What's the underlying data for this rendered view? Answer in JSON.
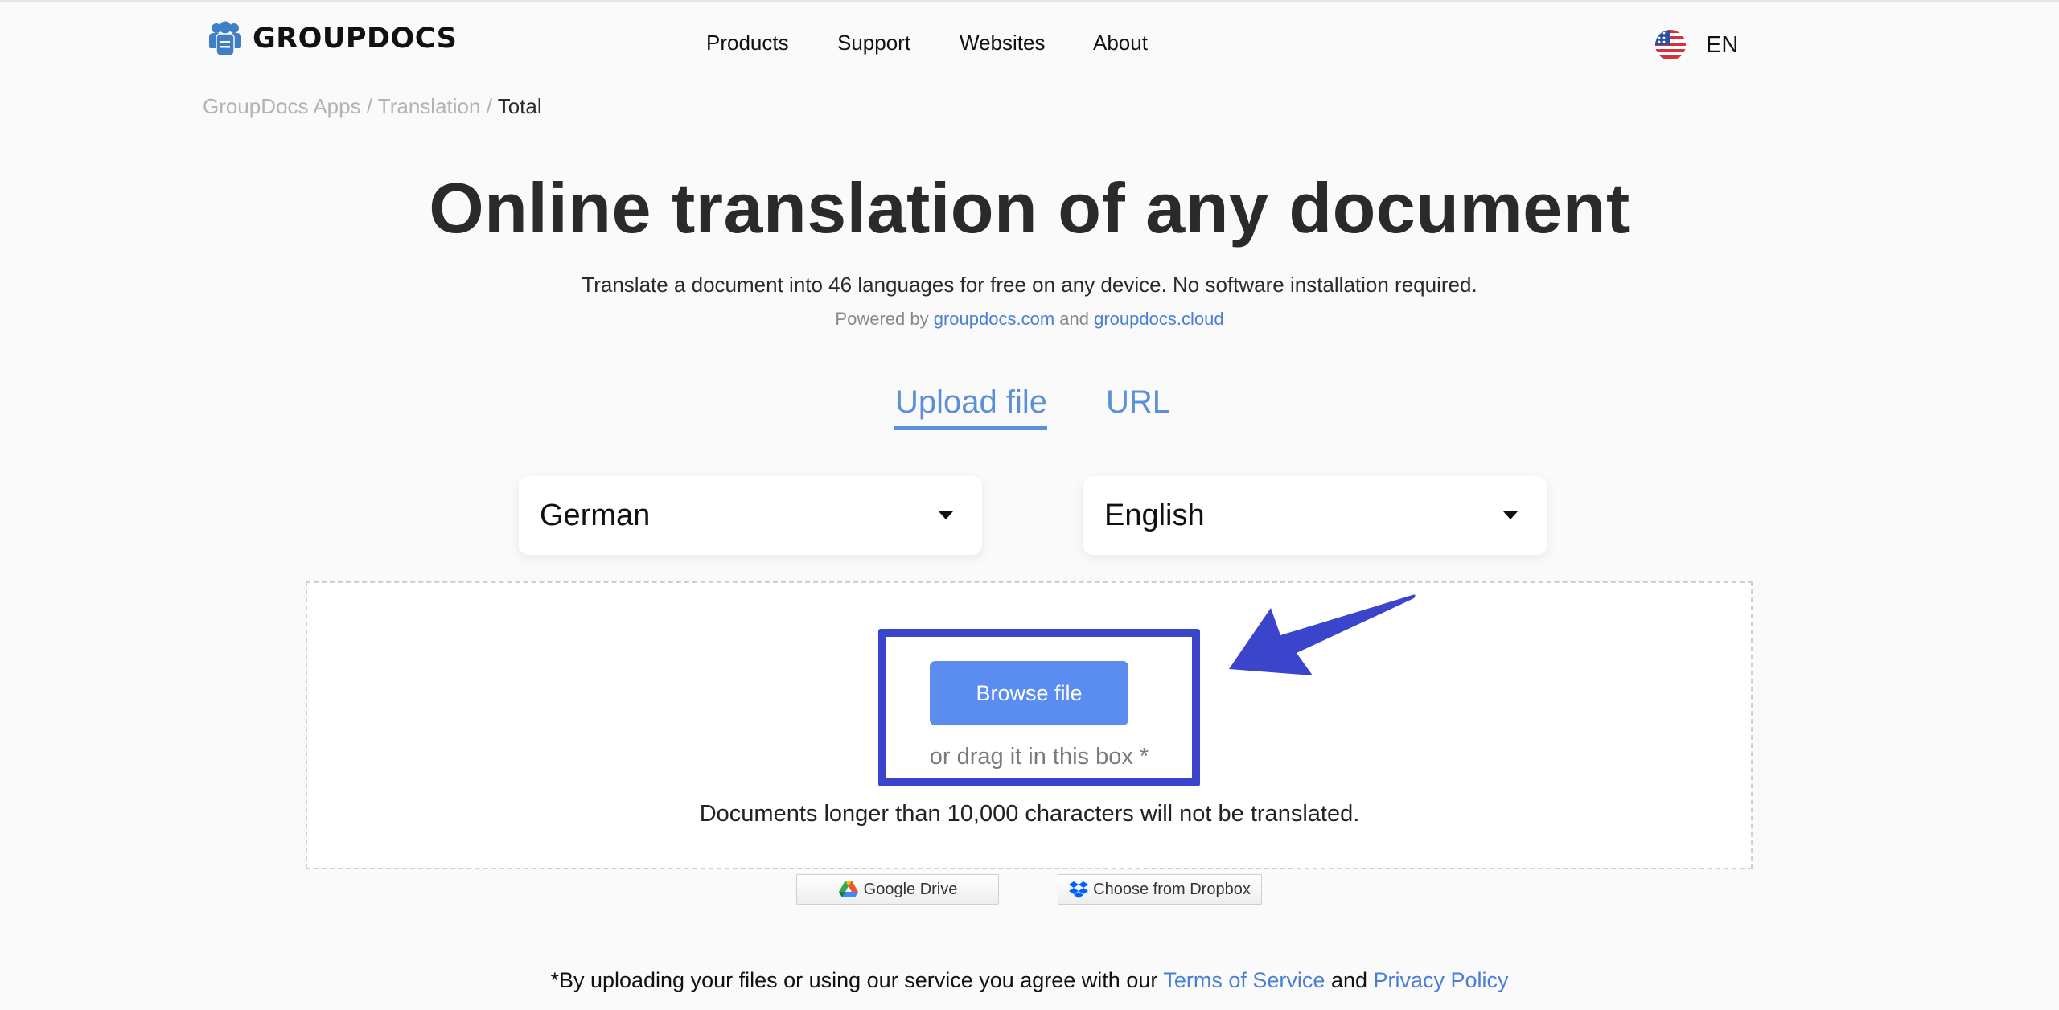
{
  "header": {
    "logo_text": "GROUPDOCS",
    "nav": [
      {
        "label": "Products"
      },
      {
        "label": "Support"
      },
      {
        "label": "Websites"
      },
      {
        "label": "About"
      }
    ],
    "language": {
      "icon": "us-flag-icon",
      "label": "EN"
    }
  },
  "breadcrumb": {
    "items": [
      "GroupDocs Apps",
      "Translation",
      "Total"
    ],
    "separator": "/"
  },
  "hero": {
    "title": "Online translation of any document",
    "subtitle": "Translate a document into 46 languages for free on any device. No software installation required.",
    "powered_prefix": "Powered by",
    "powered_link1": "groupdocs.com",
    "powered_and": "and",
    "powered_link2": "groupdocs.cloud"
  },
  "tabs": [
    {
      "label": "Upload file",
      "active": true
    },
    {
      "label": "URL",
      "active": false
    }
  ],
  "languages": {
    "source": "German",
    "target": "English"
  },
  "upload": {
    "browse_label": "Browse file",
    "drag_text": "or drag it in this box *",
    "limit_text": "Documents longer than 10,000 characters will not be translated.",
    "google_drive_label": "Google Drive",
    "dropbox_label": "Choose from Dropbox"
  },
  "footer": {
    "text": "*By uploading your files or using our service you agree with our",
    "terms_label": "Terms of Service",
    "and": "and",
    "privacy_label": "Privacy Policy"
  },
  "colors": {
    "accent": "#5b8fdc",
    "button": "#5b8cf0",
    "annotation": "#3b45cc"
  }
}
